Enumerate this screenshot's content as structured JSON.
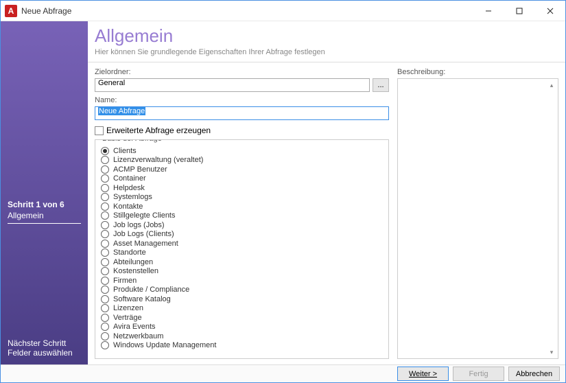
{
  "window": {
    "title": "Neue Abfrage",
    "app_icon_letter": "A"
  },
  "sidebar": {
    "step_title": "Schritt 1 von 6",
    "step_name": "Allgemein",
    "next_title": "Nächster Schritt",
    "next_name": "Felder auswählen"
  },
  "header": {
    "title": "Allgemein",
    "subtitle": "Hier können Sie grundlegende Eigenschaften Ihrer Abfrage festlegen"
  },
  "form": {
    "folder_label": "Zielordner:",
    "folder_value": "General",
    "browse_label": "...",
    "name_label": "Name:",
    "name_value": "Neue Abfrage",
    "extended_label": "Erweiterte Abfrage erzeugen",
    "basis_label": "Basis der Abfrage",
    "basis_options": [
      {
        "label": "Clients",
        "checked": true
      },
      {
        "label": "Lizenzverwaltung (veraltet)",
        "checked": false
      },
      {
        "label": "ACMP Benutzer",
        "checked": false
      },
      {
        "label": "Container",
        "checked": false
      },
      {
        "label": "Helpdesk",
        "checked": false
      },
      {
        "label": "Systemlogs",
        "checked": false
      },
      {
        "label": "Kontakte",
        "checked": false
      },
      {
        "label": "Stillgelegte Clients",
        "checked": false
      },
      {
        "label": "Job logs (Jobs)",
        "checked": false
      },
      {
        "label": "Job Logs (Clients)",
        "checked": false
      },
      {
        "label": "Asset Management",
        "checked": false
      },
      {
        "label": "Standorte",
        "checked": false
      },
      {
        "label": "Abteilungen",
        "checked": false
      },
      {
        "label": "Kostenstellen",
        "checked": false
      },
      {
        "label": "Firmen",
        "checked": false
      },
      {
        "label": "Produkte / Compliance",
        "checked": false
      },
      {
        "label": "Software Katalog",
        "checked": false
      },
      {
        "label": "Lizenzen",
        "checked": false
      },
      {
        "label": "Verträge",
        "checked": false
      },
      {
        "label": "Avira Events",
        "checked": false
      },
      {
        "label": "Netzwerkbaum",
        "checked": false
      },
      {
        "label": "Windows Update Management",
        "checked": false
      }
    ]
  },
  "right": {
    "desc_label": "Beschreibung:"
  },
  "buttons": {
    "next": "Weiter >",
    "finish": "Fertig",
    "cancel": "Abbrechen"
  }
}
